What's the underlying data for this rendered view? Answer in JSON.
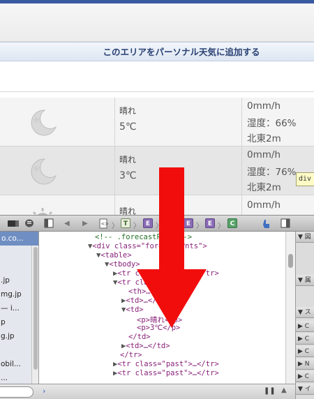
{
  "add_area_banner": "このエリアをパーソナル天気に追加する",
  "forecast_rows": [
    {
      "weather": "晴れ",
      "temp": "5℃",
      "rain": "0mm/h",
      "humidity": "湿度：66%",
      "wind": "北東2m",
      "icon": "moon-night-icon"
    },
    {
      "weather": "晴れ",
      "temp": "3℃",
      "rain": "0mm/h",
      "humidity": "湿度：76%",
      "wind": "北東2m",
      "icon": "moon-night-icon"
    },
    {
      "weather": "晴れ",
      "temp": "",
      "rain": "0mm/h",
      "humidity": "",
      "wind": "",
      "icon": "sun-icon"
    }
  ],
  "tooltip": "div",
  "inspector": {
    "left_panel_header": "o.co...",
    "left_items": [
      ".jp",
      "mg.jp",
      "— i...",
      "p",
      "g.jp",
      "",
      "obil...",
      "..."
    ],
    "dom_lines": [
      {
        "indent": 0,
        "tri": "",
        "text": "<!-- .forecastPnts -->",
        "kind": "comment"
      },
      {
        "indent": 0,
        "tri": "▼",
        "text": "<div class=\"forecastPnts\">",
        "kind": "tag"
      },
      {
        "indent": 1,
        "tri": "▼",
        "text": "<table>",
        "kind": "tag"
      },
      {
        "indent": 2,
        "tri": "▼",
        "text": "<tbody>",
        "kind": "tag"
      },
      {
        "indent": 3,
        "tri": "▶",
        "text": "<tr class=\"past\">…</tr>",
        "kind": "tag"
      },
      {
        "indent": 3,
        "tri": "▼",
        "text": "<tr class=\"past\">",
        "kind": "tag"
      },
      {
        "indent": 4,
        "tri": "",
        "text": "<th>…</th>",
        "kind": "tag"
      },
      {
        "indent": 4,
        "tri": "▶",
        "text": "<td>…</td>",
        "kind": "tag"
      },
      {
        "indent": 4,
        "tri": "▼",
        "text": "<td>",
        "kind": "tag"
      },
      {
        "indent": 5,
        "tri": "",
        "text": "<p>晴れ</p>",
        "kind": "tag"
      },
      {
        "indent": 5,
        "tri": "",
        "text": "<p>3℃</p>",
        "kind": "tag"
      },
      {
        "indent": 4,
        "tri": "",
        "text": "</td>",
        "kind": "tag"
      },
      {
        "indent": 4,
        "tri": "▶",
        "text": "<td>…</td>",
        "kind": "tag"
      },
      {
        "indent": 3,
        "tri": "",
        "text": "</tr>",
        "kind": "tag"
      },
      {
        "indent": 3,
        "tri": "▶",
        "text": "<tr class=\"past\">…</tr>",
        "kind": "tag"
      },
      {
        "indent": 3,
        "tri": "▶",
        "text": "<tr class=\"past\">…</tr>",
        "kind": "tag"
      }
    ],
    "right_sections": [
      "▼ 図",
      "▼ 属",
      "▼ ス",
      "▶ C",
      "▶ C",
      "▶ C",
      "▶ N",
      "▶ C",
      "▼ イ"
    ],
    "console_prompt": "›"
  }
}
